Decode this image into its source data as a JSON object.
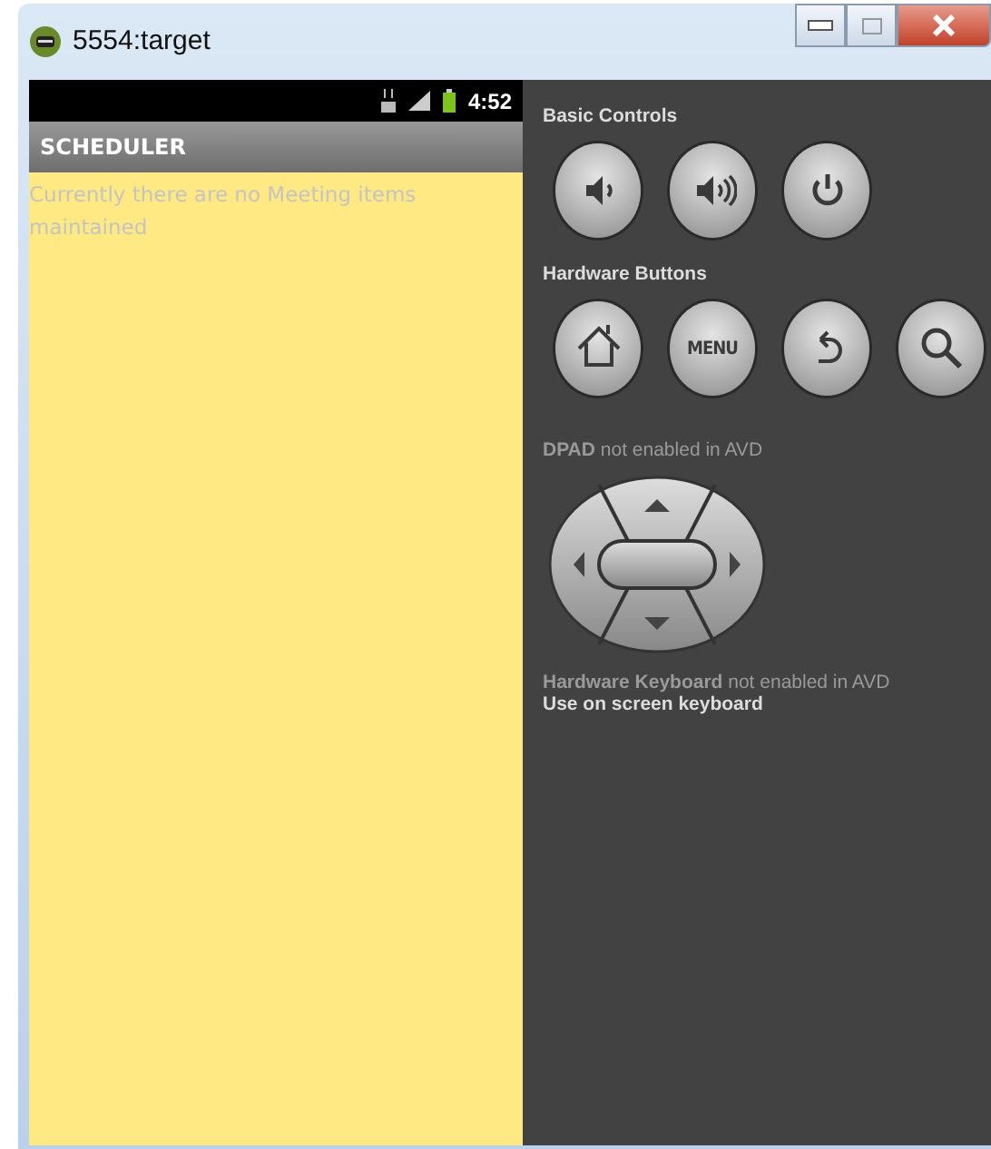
{
  "window": {
    "title": "5554:target"
  },
  "status_bar": {
    "time": "4:52"
  },
  "app": {
    "title": "SCHEDULER",
    "message": "Currently there are no Meeting items maintained"
  },
  "controls": {
    "basic_title": "Basic Controls",
    "basic_buttons": [
      {
        "kind": "volume-down"
      },
      {
        "kind": "volume-up"
      },
      {
        "kind": "power"
      }
    ],
    "hardware_title": "Hardware Buttons",
    "hardware_buttons": [
      {
        "kind": "home"
      },
      {
        "kind": "menu",
        "label": "MENU"
      },
      {
        "kind": "back"
      },
      {
        "kind": "search"
      }
    ],
    "dpad_note": "**DPAD** not enabled in AVD",
    "keyboard_note": "**Hardware Keyboard** not enabled in AVD",
    "keyboard_hint": "Use on screen keyboard"
  }
}
